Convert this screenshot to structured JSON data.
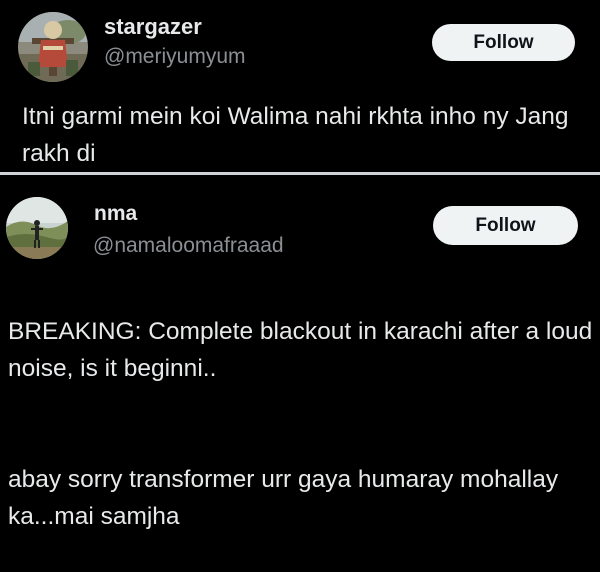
{
  "tweets": [
    {
      "display_name": "stargazer",
      "handle": "@meriyumyum",
      "follow_label": "Follow",
      "avatar_icon": "scarecrow-avatar-icon",
      "text": "Itni garmi mein koi Walima nahi rkhta inho ny Jang rakh di"
    },
    {
      "display_name": "nma",
      "handle": "@namaloomafraaad",
      "follow_label": "Follow",
      "avatar_icon": "landscape-person-avatar-icon",
      "paragraphs": [
        "BREAKING: Complete blackout in karachi after a loud noise, is it beginni..",
        "abay sorry transformer urr gaya humaray mohallay ka...mai samjha"
      ]
    }
  ],
  "colors": {
    "background": "#000000",
    "text": "#e7e9ea",
    "handle": "#8b8f94",
    "follow_bg": "#eff3f4",
    "follow_text": "#0f1419",
    "divider": "#cfd2d6"
  }
}
